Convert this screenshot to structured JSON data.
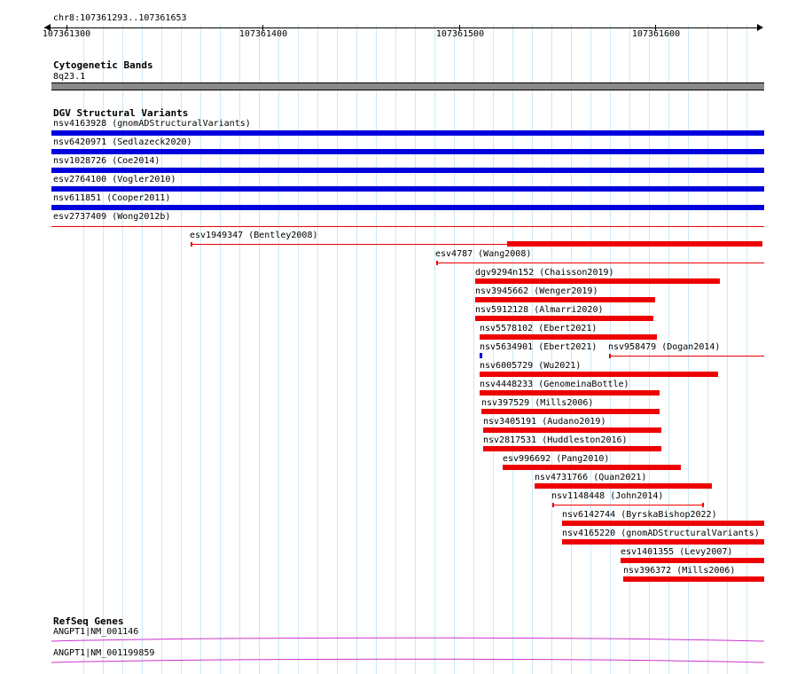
{
  "locus": "chr8:107361293..107361653",
  "ruler": {
    "ticks": [
      "107361300",
      "107361400",
      "107361500",
      "107361600"
    ]
  },
  "cytoband": {
    "title": "Cytogenetic Bands",
    "band": "8q23.1",
    "color": "#8a8a8a"
  },
  "dgv": {
    "title": "DGV Structural Variants",
    "colors": {
      "loss": "#ff0000",
      "gain": "#0000dd"
    },
    "full_span_variants": [
      "nsv4163928 (gnomADStructuralVariants)",
      "nsv6420971 (Sedlazeck2020)",
      "nsv1028726 (Coe2014)",
      "esv2764100 (Vogler2010)",
      "nsv611851 (Cooper2011)",
      "esv2737409 (Wong2012b)"
    ],
    "partial_variants": [
      "esv1949347 (Bentley2008)",
      "esv4787 (Wang2008)",
      "dgv9294n152 (Chaisson2019)",
      "nsv3945662 (Wenger2019)",
      "nsv5912128 (Almarri2020)",
      "nsv5578102 (Ebert2021)",
      "nsv5634901 (Ebert2021)",
      "nsv958479 (Dogan2014)",
      "nsv6005729 (Wu2021)",
      "nsv4448233 (GenomeinaBottle)",
      "nsv397529 (Mills2006)",
      "nsv3405191 (Audano2019)",
      "nsv2817531 (Huddleston2016)",
      "esv996692 (Pang2010)",
      "nsv4731766 (Quan2021)",
      "nsv1148448 (John2014)",
      "nsv6142744 (ByrskaBishop2022)",
      "nsv4165220 (gnomADStructuralVariants)",
      "esv1401355 (Levy2007)",
      "nsv396372 (Mills2006)"
    ]
  },
  "refseq": {
    "title": "RefSeq Genes",
    "transcripts": [
      "ANGPT1|NM_001146",
      "ANGPT1|NM_001199859"
    ],
    "color": "#cc33cc"
  }
}
